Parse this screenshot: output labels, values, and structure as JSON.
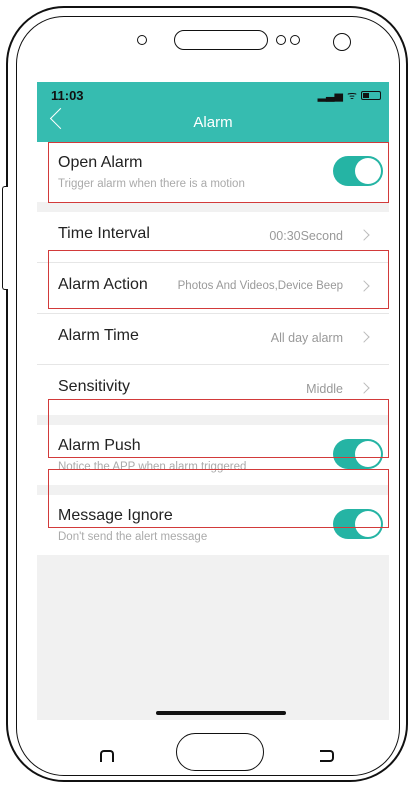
{
  "status_bar": {
    "time": "11:03",
    "signal": "▂▃▅",
    "wifi": "ᯤ"
  },
  "header": {
    "title": "Alarm"
  },
  "rows": {
    "open_alarm": {
      "label": "Open Alarm",
      "sub": "Trigger alarm when there is a motion",
      "enabled": true
    },
    "time_interval": {
      "label": "Time Interval",
      "value": "00:30Second"
    },
    "alarm_action": {
      "label": "Alarm Action",
      "value": "Photos And Videos,Device Beep"
    },
    "alarm_time": {
      "label": "Alarm Time",
      "value": "All day alarm"
    },
    "sensitivity": {
      "label": "Sensitivity",
      "value": "Middle"
    },
    "alarm_push": {
      "label": "Alarm Push",
      "sub": "Notice the APP when alarm triggered",
      "enabled": true
    },
    "message_ignore": {
      "label": "Message Ignore",
      "sub": "Don't send the alert message",
      "enabled": true
    }
  },
  "colors": {
    "accent": "#36bcb0",
    "toggle_on": "#25b4a4",
    "highlight": "#d23a3a"
  }
}
